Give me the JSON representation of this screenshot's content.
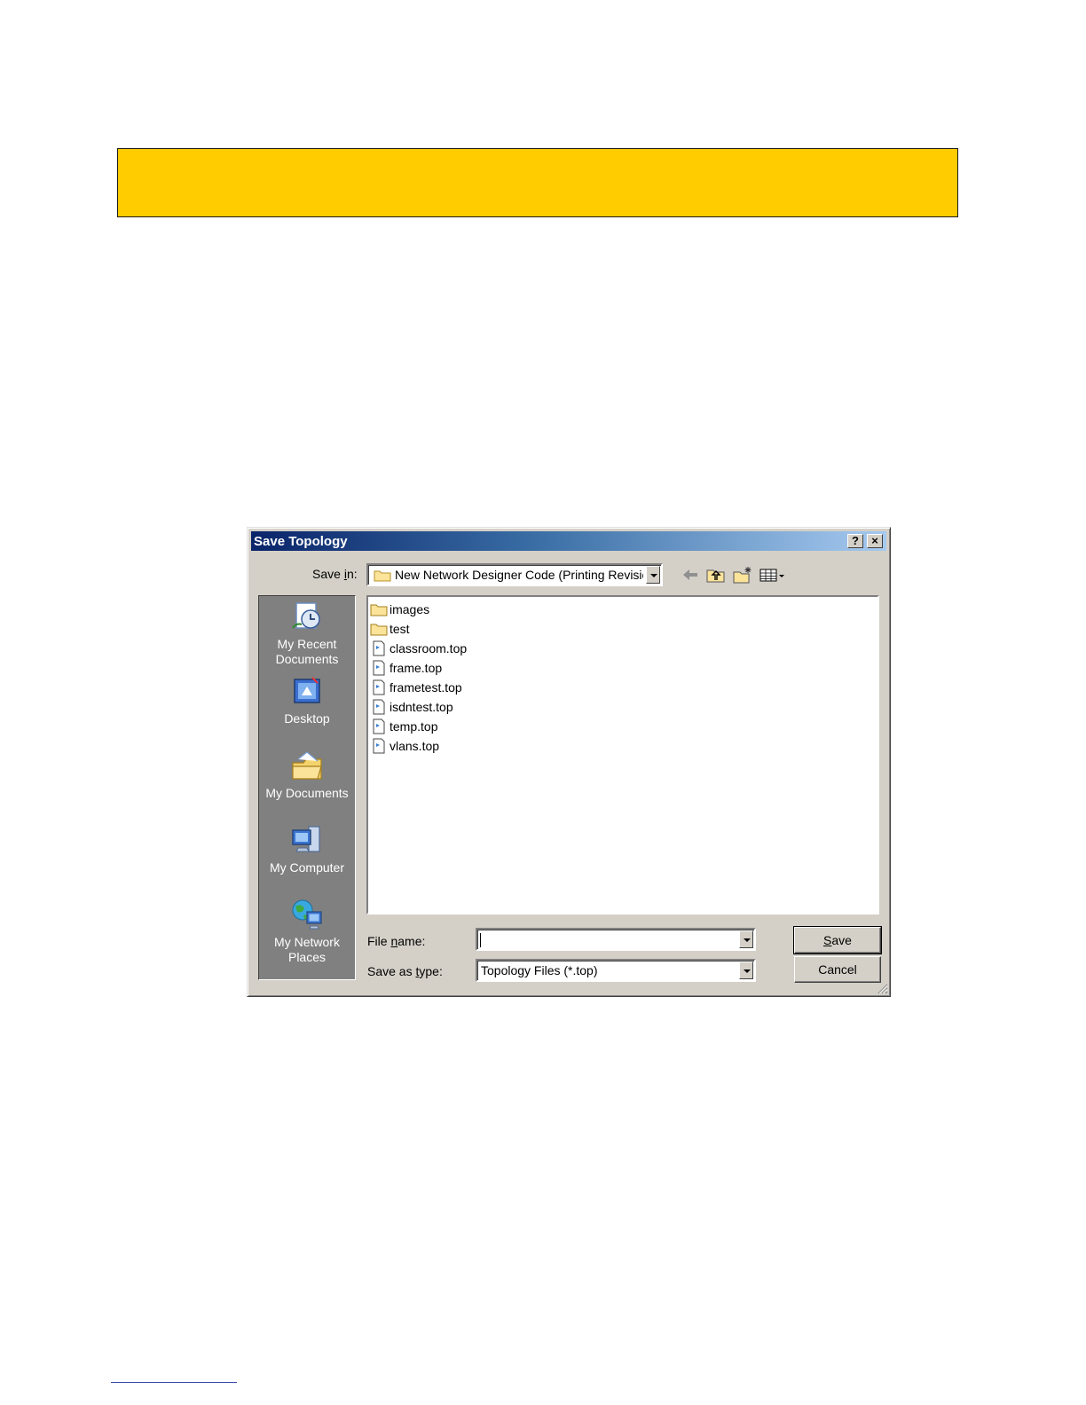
{
  "dialog": {
    "title": "Save Topology",
    "help_glyph": "?",
    "close_glyph": "×",
    "save_in": {
      "label_pre": "Save ",
      "label_key": "i",
      "label_post": "n:",
      "value": "New Network Designer Code (Printing Revisio"
    },
    "toolbar_icons": [
      "back-arrow-icon",
      "up-one-level-icon",
      "new-folder-icon",
      "view-menu-icon"
    ],
    "places": [
      {
        "line1": "My Recent",
        "line2": "Documents",
        "icon": "recent-documents-icon"
      },
      {
        "line1": "Desktop",
        "line2": "",
        "icon": "desktop-icon"
      },
      {
        "line1": "My Documents",
        "line2": "",
        "icon": "my-documents-icon"
      },
      {
        "line1": "My Computer",
        "line2": "",
        "icon": "my-computer-icon"
      },
      {
        "line1": "My Network",
        "line2": "Places",
        "icon": "network-places-icon"
      }
    ],
    "files": [
      {
        "name": "images",
        "type": "folder"
      },
      {
        "name": "test",
        "type": "folder"
      },
      {
        "name": "classroom.top",
        "type": "file"
      },
      {
        "name": "frame.top",
        "type": "file"
      },
      {
        "name": "frametest.top",
        "type": "file"
      },
      {
        "name": "isdntest.top",
        "type": "file"
      },
      {
        "name": "temp.top",
        "type": "file"
      },
      {
        "name": "vlans.top",
        "type": "file"
      }
    ],
    "file_name": {
      "label_pre": "File ",
      "label_key": "n",
      "label_post": "ame:",
      "value": ""
    },
    "save_as_type": {
      "label_pre": "Save as ",
      "label_key": "t",
      "label_post": "ype:",
      "value": "Topology Files (*.top)"
    },
    "save_button": {
      "key": "S",
      "rest": "ave"
    },
    "cancel_button": "Cancel"
  },
  "colors": {
    "banner": "#ffcc00",
    "titlebar_start": "#0a246a",
    "titlebar_end": "#a6caf0",
    "dialog_face": "#d4d0c8"
  }
}
